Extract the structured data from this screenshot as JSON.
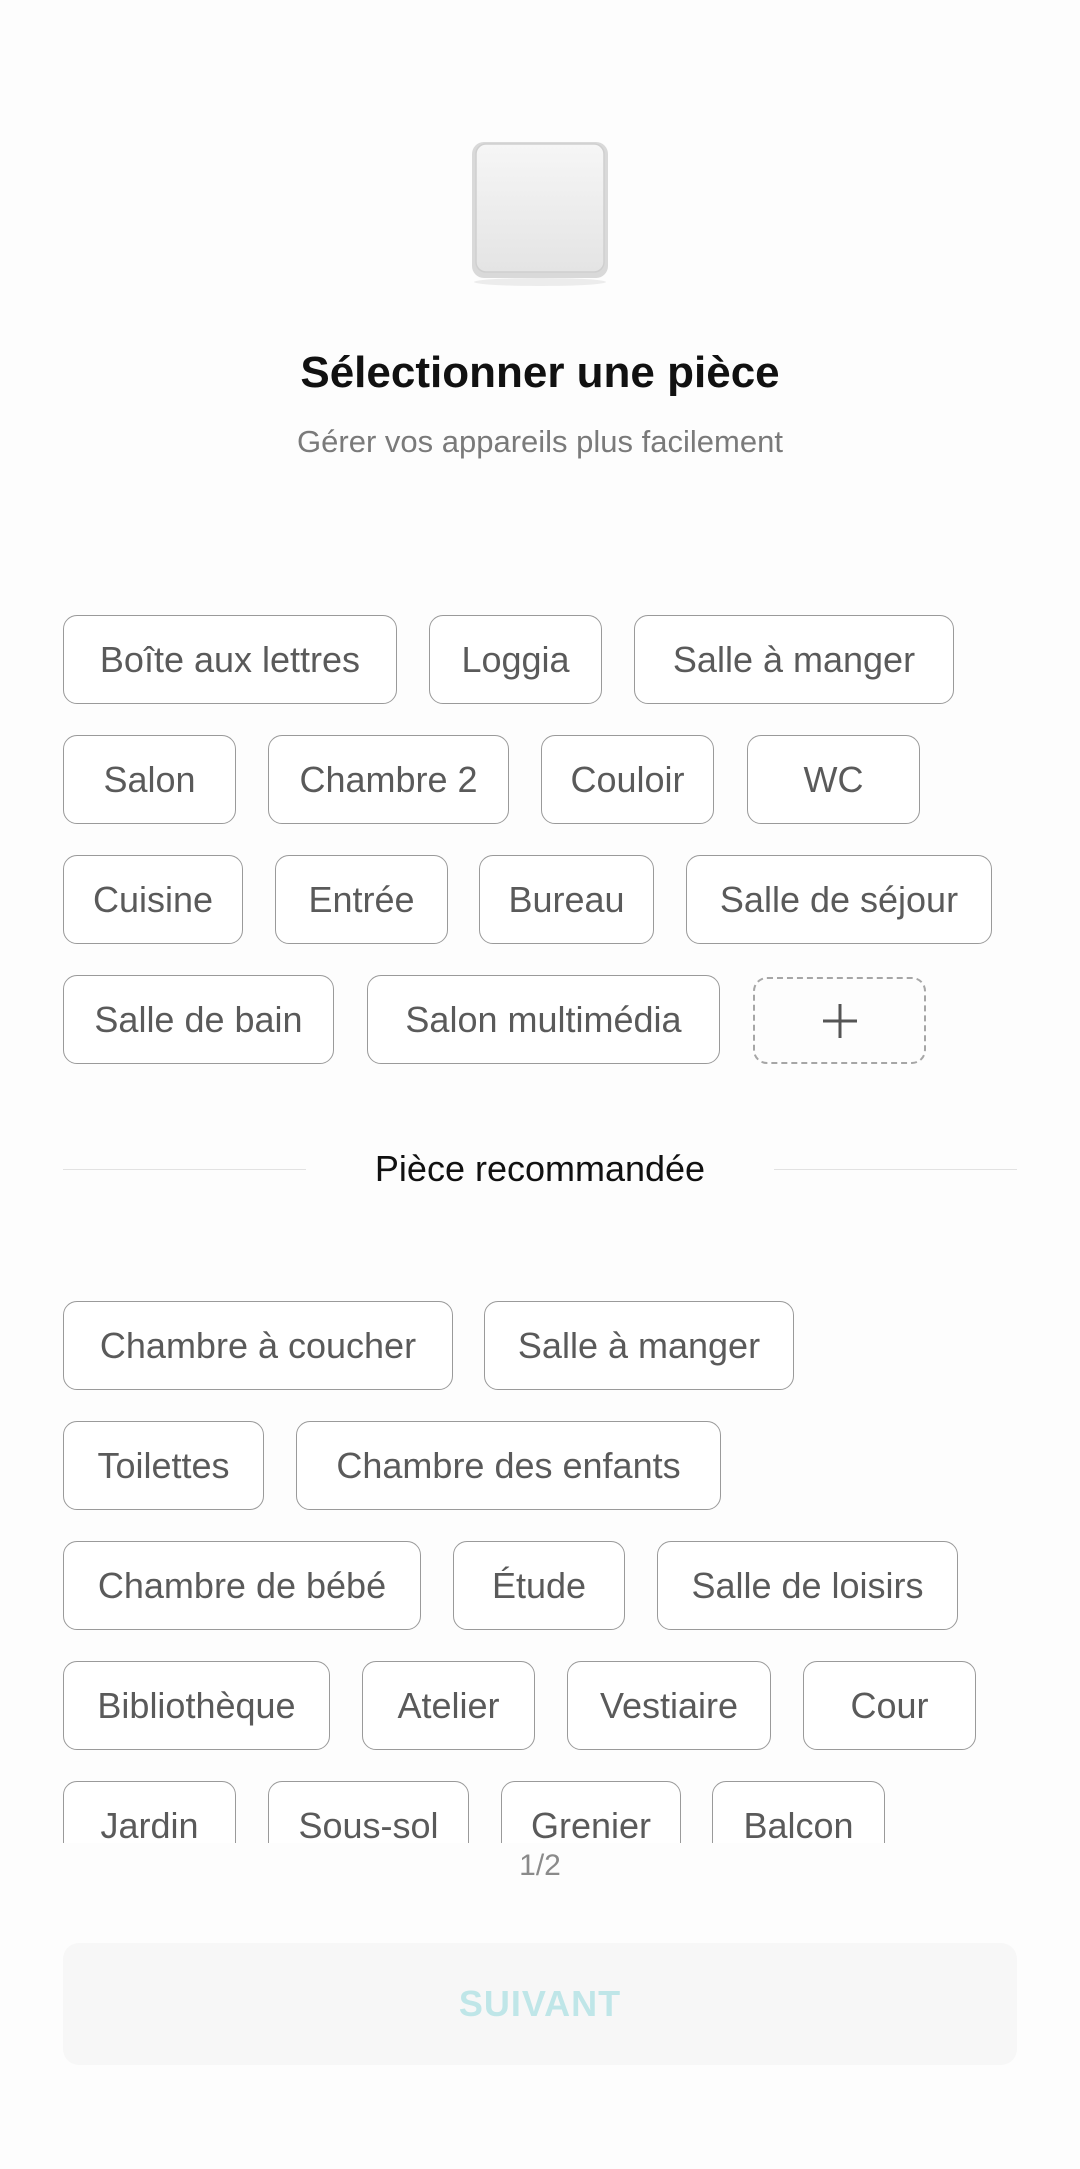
{
  "header": {
    "icon": "light-switch-icon",
    "title": "Sélectionner une pièce",
    "subtitle": "Gérer vos appareils plus facilement"
  },
  "rooms": {
    "items": [
      "Boîte aux lettres",
      "Loggia",
      "Salle à manger",
      "Salon",
      "Chambre 2",
      "Couloir",
      "WC",
      "Cuisine",
      "Entrée",
      "Bureau",
      "Salle de séjour",
      "Salle de bain",
      "Salon multimédia"
    ],
    "add_icon": "plus-icon"
  },
  "recommended": {
    "label": "Pièce recommandée",
    "items": [
      "Chambre à coucher",
      "Salle à manger",
      "Toilettes",
      "Chambre des enfants",
      "Chambre de bébé",
      "Étude",
      "Salle de loisirs",
      "Bibliothèque",
      "Atelier",
      "Vestiaire",
      "Cour",
      "Jardin",
      "Sous-sol",
      "Grenier",
      "Balcon"
    ]
  },
  "pager": {
    "text": "1/2"
  },
  "footer": {
    "next_label": "SUIVANT"
  },
  "colors": {
    "chip_border": "#9a9a9a",
    "chip_text": "#5a5a5a",
    "button_text_disabled": "#bfe6e8",
    "button_background": "#f7f7f7"
  }
}
